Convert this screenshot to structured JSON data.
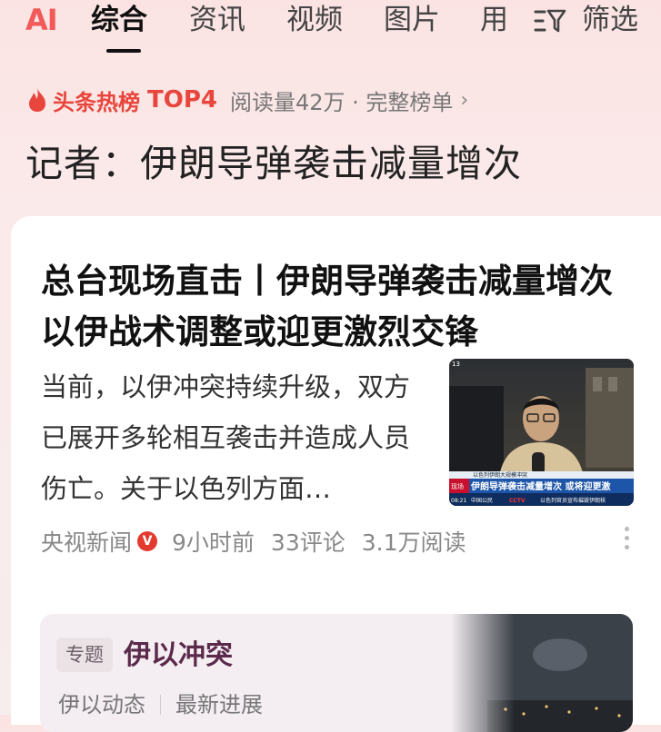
{
  "tabs": {
    "ai": "AI",
    "items": [
      "综合",
      "资讯",
      "视频",
      "图片",
      "用"
    ],
    "filter": "筛选"
  },
  "hot": {
    "tag": "头条热榜",
    "rank": "TOP4",
    "meta": "阅读量42万 · 完整榜单",
    "chevron": "›"
  },
  "headline": "记者：伊朗导弹袭击减量增次",
  "article": {
    "title": "总台现场直击丨伊朗导弹袭击减量增次 以伊战术调整或迎更激烈交锋",
    "summary": "当前，以伊冲突持续升级，双方已展开多轮相互袭击并造成人员伤亡。关于以色列方面…",
    "source": "央视新闻",
    "verified_badge": "V",
    "time": "9小时前",
    "comments": "33评论",
    "reads": "3.1万阅读",
    "thumb": {
      "channel": "13",
      "ticker_top": "以色列伊朗大规模冲突",
      "ticker_main": "伊朗导弹袭击减量增次 或将迎更激",
      "ticker_bottom": "以色列官员宣布摧毁伊朗核",
      "time": "08:21",
      "live": "现场",
      "location": "中国公民",
      "logo": "CCTV"
    }
  },
  "topic": {
    "tag": "专题",
    "title": "伊以冲突",
    "links": [
      "伊以动态",
      "最新进展"
    ]
  },
  "colors": {
    "accent_red": "#e8453c",
    "ai_red": "#f25a5a",
    "topic_title": "#5b2a4a"
  }
}
